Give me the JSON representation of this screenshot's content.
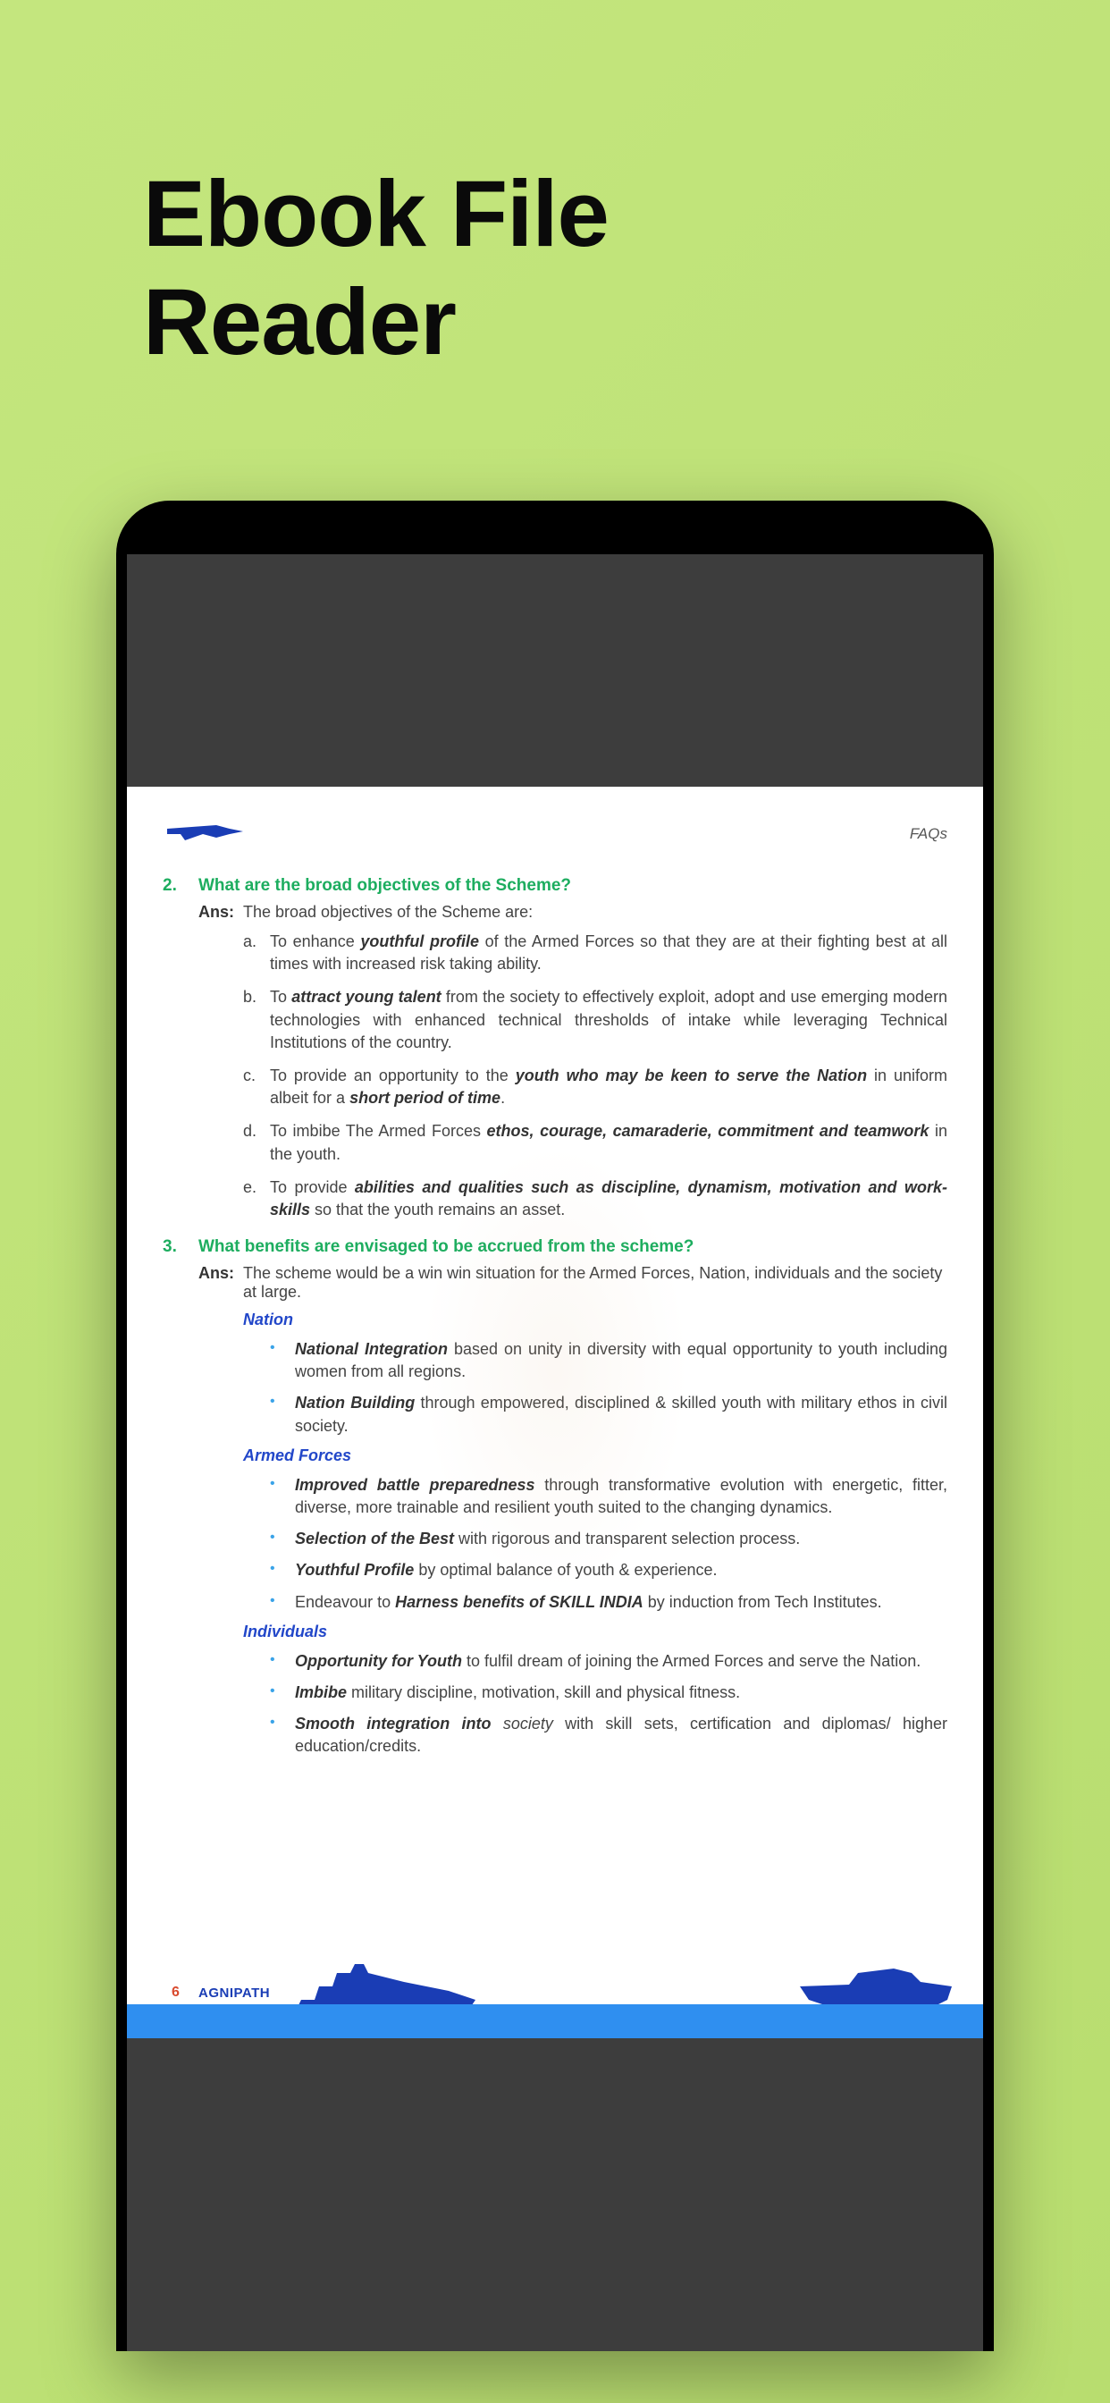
{
  "app": {
    "title": "Ebook File\nReader"
  },
  "doc": {
    "header_label": "FAQs",
    "q2": {
      "num": "2.",
      "text": "What are the broad objectives of the Scheme?",
      "ans_label": "Ans:",
      "ans_intro": "The broad objectives of the Scheme are:",
      "items": {
        "a": {
          "marker": "a.",
          "pre": "To enhance ",
          "bold": "youthful profile",
          "post": " of the Armed Forces so that they are at their fighting best at all times with increased risk taking ability."
        },
        "b": {
          "marker": "b.",
          "pre": "To ",
          "bold": "attract young talent",
          "post": " from the society to effectively exploit, adopt and use emerging modern technologies with enhanced technical thresholds of intake while leveraging Technical Institutions of the country."
        },
        "c": {
          "marker": "c.",
          "pre": "To provide an opportunity to the ",
          "bold": "youth who may be keen to serve the Nation",
          "mid": " in uniform albeit for a ",
          "bold2": "short period of time",
          "post": "."
        },
        "d": {
          "marker": "d.",
          "pre": "To imbibe The Armed Forces ",
          "bold": "ethos, courage, camaraderie, commitment and teamwork",
          "post": " in the youth."
        },
        "e": {
          "marker": "e.",
          "pre": "To provide ",
          "bold": "abilities and qualities such as discipline, dynamism, motivation and work-skills",
          "post": " so that the youth remains an asset."
        }
      }
    },
    "q3": {
      "num": "3.",
      "text": "What benefits are envisaged to be accrued from the scheme?",
      "ans_label": "Ans:",
      "ans_intro": "The scheme would be a win win situation for the Armed Forces, Nation, individuals and the society at large.",
      "nation_heading": "Nation",
      "nation": {
        "a": {
          "bold": "National Integration",
          "post": " based on unity in diversity with equal opportunity to youth including women from all regions."
        },
        "b": {
          "bold": "Nation Building",
          "post": " through empowered, disciplined & skilled youth with military ethos in civil society."
        }
      },
      "armed_heading": "Armed Forces",
      "armed": {
        "a": {
          "bold": "Improved battle preparedness",
          "post": " through transformative evolution with energetic, fitter, diverse, more trainable and resilient youth suited to the changing dynamics."
        },
        "b": {
          "bold": "Selection of the Best",
          "post": " with rigorous and transparent selection process."
        },
        "c": {
          "bold": "Youthful Profile",
          "post": " by optimal balance of youth & experience."
        },
        "d": {
          "pre": "Endeavour to ",
          "bold": "Harness benefits of SKILL INDIA",
          "post": " by induction from Tech Institutes."
        }
      },
      "indiv_heading": "Individuals",
      "indiv": {
        "a": {
          "bold": "Opportunity for Youth",
          "post": " to fulfil dream of joining the Armed Forces and serve the Nation."
        },
        "b": {
          "bold": "Imbibe",
          "post": " military discipline, motivation, skill and physical fitness."
        },
        "c": {
          "bold": "Smooth integration into",
          "mid": " society",
          "post": " with skill sets, certification and diplomas/ higher education/credits."
        }
      }
    },
    "footer": {
      "page_num": "6",
      "brand": "AGNIPATH"
    }
  }
}
